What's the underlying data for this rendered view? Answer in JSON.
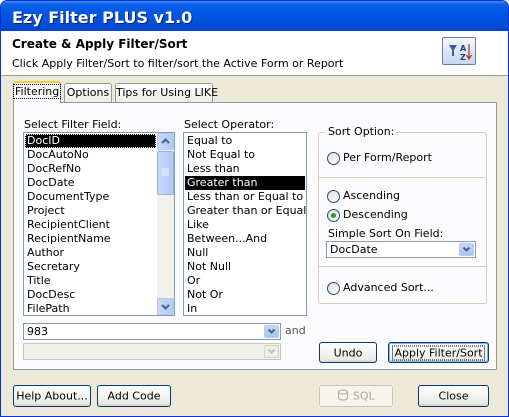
{
  "window": {
    "title": "Ezy Filter PLUS v1.0"
  },
  "header": {
    "title": "Create & Apply Filter/Sort",
    "subtitle": "Click Apply Filter/Sort to filter/sort the Active Form or Report",
    "icon": "sort-az-icon"
  },
  "tabs": [
    {
      "label": "Filtering",
      "active": true
    },
    {
      "label": "Options",
      "active": false
    },
    {
      "label": "Tips for Using LIKE",
      "active": false
    }
  ],
  "filter_field": {
    "label": "Select Filter Field:",
    "items": [
      "DocID",
      "DocAutoNo",
      "DocRefNo",
      "DocDate",
      "DocumentType",
      "Project",
      "RecipientClient",
      "RecipientName",
      "Author",
      "Secretary",
      "Title",
      "DocDesc",
      "FilePath"
    ],
    "selected": "DocID"
  },
  "operator": {
    "label": "Select Operator:",
    "items": [
      "Equal to",
      "Not Equal to",
      "Less than",
      "Greater than",
      "Less than or Equal to",
      "Greater than or Equal to",
      "Like",
      "Between...And",
      "Null",
      "Not Null",
      "Or",
      "Not Or",
      "In"
    ],
    "selected": "Greater than"
  },
  "value1": {
    "value": "983"
  },
  "and_label": "and",
  "value2": {
    "value": ""
  },
  "sort_option": {
    "label": "Sort Option:",
    "per_form_report": "Per Form/Report",
    "ascending": "Ascending",
    "descending": "Descending",
    "selected": "Descending",
    "simple_sort_label": "Simple Sort On Field:",
    "simple_sort_value": "DocDate",
    "advanced_sort": "Advanced Sort..."
  },
  "buttons": {
    "undo": "Undo",
    "apply": "Apply Filter/Sort",
    "help_about": "Help About...",
    "add_code": "Add Code",
    "sql": "SQL",
    "close": "Close"
  },
  "colors": {
    "title_bar": "#0054e3",
    "selection": "#000000",
    "radio_dot": "#21a121",
    "tab_highlight": "#ffc83c"
  }
}
